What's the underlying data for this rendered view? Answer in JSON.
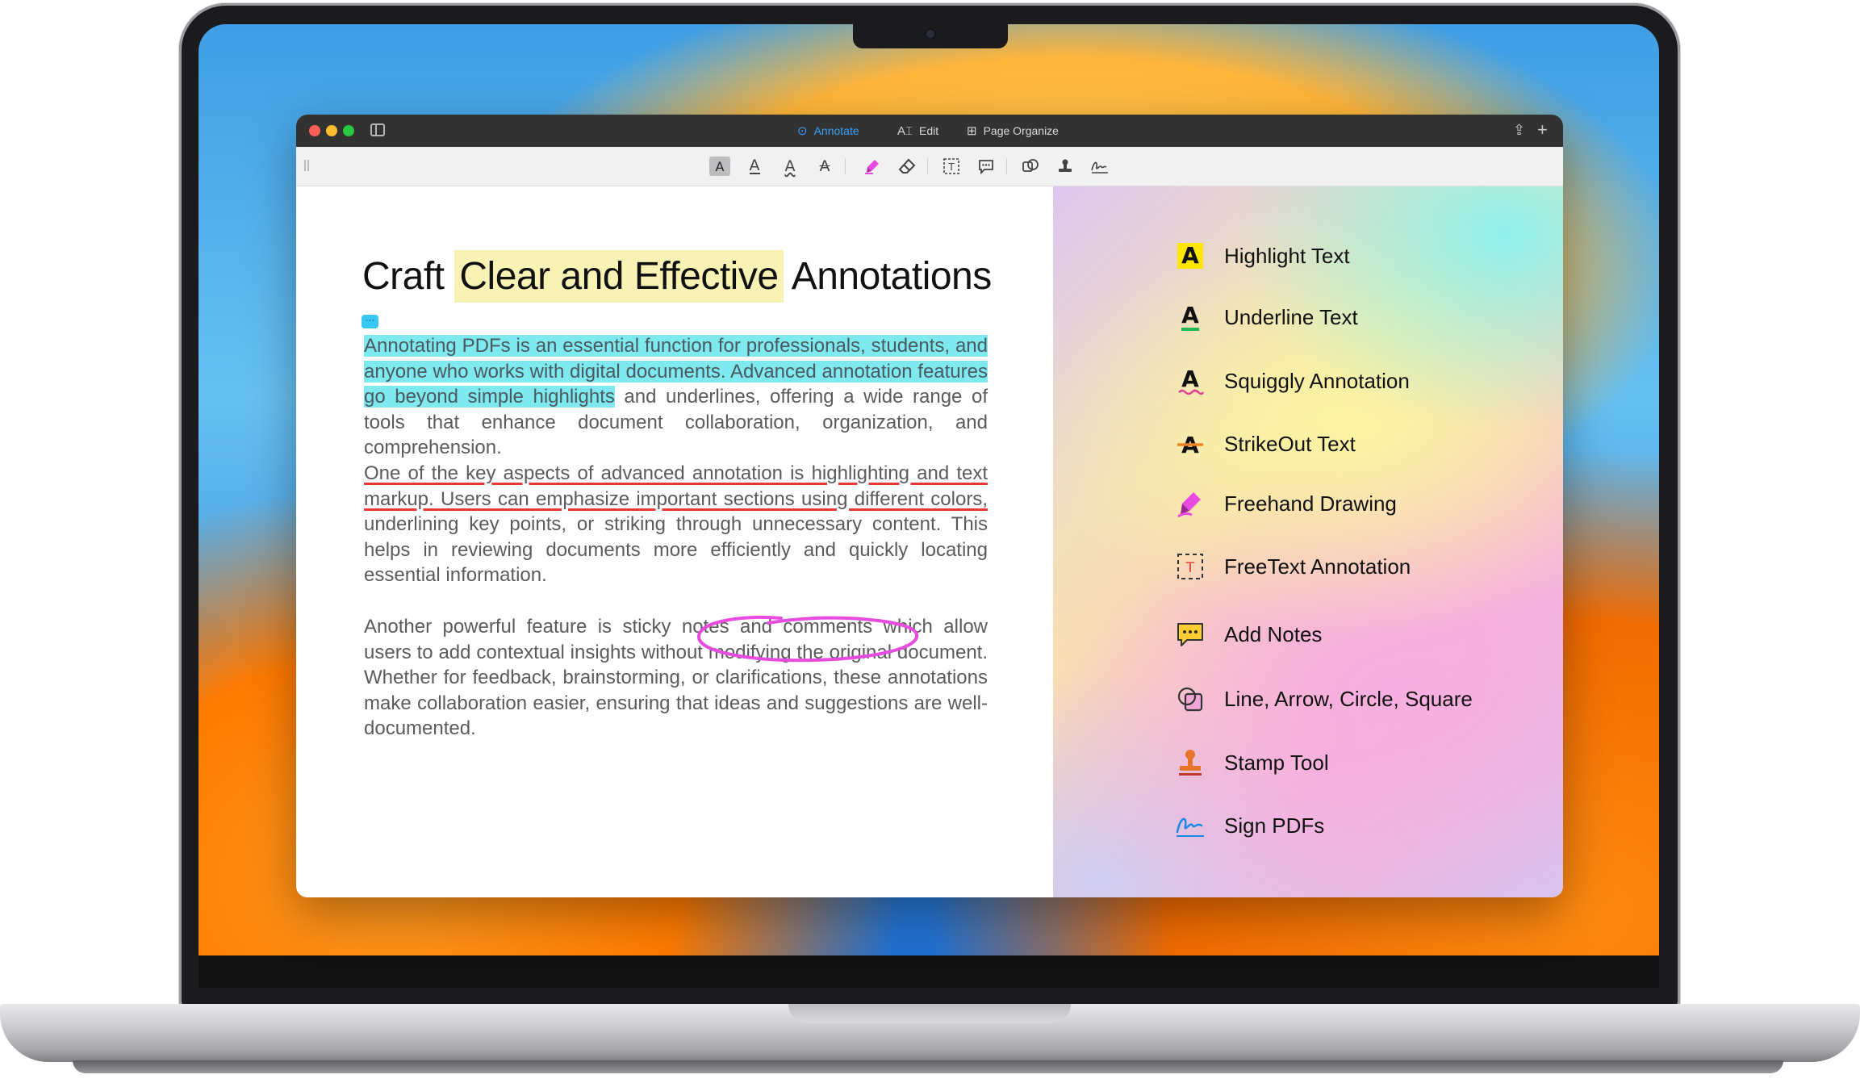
{
  "window": {
    "tabs": [
      {
        "label": "Annotate",
        "icon": "annotate-icon",
        "active": true
      },
      {
        "label": "Edit",
        "icon": "edit-icon",
        "active": false
      },
      {
        "label": "Page Organize",
        "icon": "grid-icon",
        "active": false
      }
    ]
  },
  "toolbar": {
    "tools": [
      "highlight-tool",
      "underline-tool",
      "squiggly-tool",
      "strikeout-tool",
      "freehand-tool",
      "eraser-tool",
      "freetext-tool",
      "note-tool",
      "shapes-tool",
      "stamp-tool",
      "signature-tool"
    ]
  },
  "document": {
    "title_pre": "Craft",
    "title_highlight": "Clear and Effective",
    "title_post": "Annotations",
    "p1_highlighted": "Annotating PDFs is an essential function for professionals, students, and anyone who works with digital documents. Advanced annotation features go beyond simple highlights",
    "p1_rest": " and underlines, offering a wide range of tools that enhance document collaboration, organization, and comprehension.",
    "p2_underlined": "One of the key aspects of advanced annotation is highlighting and text markup. Users can emphasize important sections using different colors,",
    "p2_rest": " underlining key points, or striking through unnecessary content. This helps in reviewing documents more efficiently and quickly locating essential information.",
    "p3": "Another powerful feature is sticky notes and comments which allow users to add contextual insights without modifying the original document. Whether for feedback, brainstorming, or clarifications, these annotations make collaboration easier, ensuring that ideas and suggestions are well-documented."
  },
  "features": [
    {
      "label": "Highlight Text",
      "icon": "highlight-text-icon"
    },
    {
      "label": "Underline Text",
      "icon": "underline-text-icon"
    },
    {
      "label": "Squiggly Annotation",
      "icon": "squiggly-icon"
    },
    {
      "label": "StrikeOut Text",
      "icon": "strikeout-icon"
    },
    {
      "label": "Freehand Drawing",
      "icon": "marker-icon"
    },
    {
      "label": "FreeText Annotation",
      "icon": "freetext-icon"
    },
    {
      "label": "Add Notes",
      "icon": "note-icon"
    },
    {
      "label": "Line, Arrow, Circle, Square",
      "icon": "shapes-icon"
    },
    {
      "label": "Stamp Tool",
      "icon": "stamp-icon"
    },
    {
      "label": "Sign PDFs",
      "icon": "signature-icon"
    }
  ],
  "colors": {
    "accent": "#3a9ff5",
    "title_highlight": "#f8f3b5",
    "text_highlight": "#7fe9f0",
    "underline": "#e53935",
    "freehand": "#e84be0"
  }
}
